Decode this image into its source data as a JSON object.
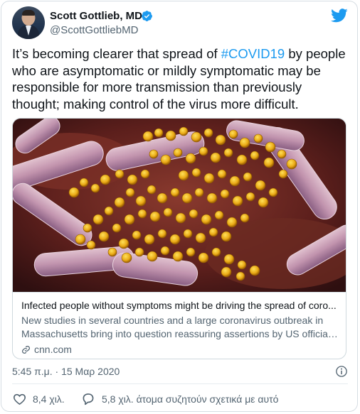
{
  "author": {
    "display_name": "Scott Gottlieb, MD",
    "handle": "@ScottGottliebMD"
  },
  "tweet": {
    "text_before": "It’s becoming clearer that spread of ",
    "hashtag": "#COVID19",
    "text_after": " by people who are asymptomatic or mildly symptomatic may be responsible for more transmission than previously thought; making control of the virus more difficult."
  },
  "card": {
    "title": "Infected people without symptoms might be driving the spread of coro...",
    "description_line1": "New studies in several countries and a large coronavirus outbreak in",
    "description_line2": "Massachusetts bring into question reassuring assertions by US officials ...",
    "domain": "cnn.com"
  },
  "meta": {
    "timestamp": "5:45 π.μ. · 15 Μαρ 2020"
  },
  "actions": {
    "like_count": "8,4 χιλ.",
    "reply_text": "5,8 χιλ. άτομα συζητούν σχετικά με αυτό"
  },
  "colors": {
    "accent": "#1d9bf0",
    "text_primary": "#0f1419",
    "text_secondary": "#536471",
    "like_red": "#e0245e"
  },
  "icons": {
    "verified": "verified-badge-icon",
    "logo": "twitter-bird-icon",
    "link": "link-icon",
    "info": "info-icon",
    "like": "heart-icon",
    "reply": "reply-bubble-icon"
  }
}
